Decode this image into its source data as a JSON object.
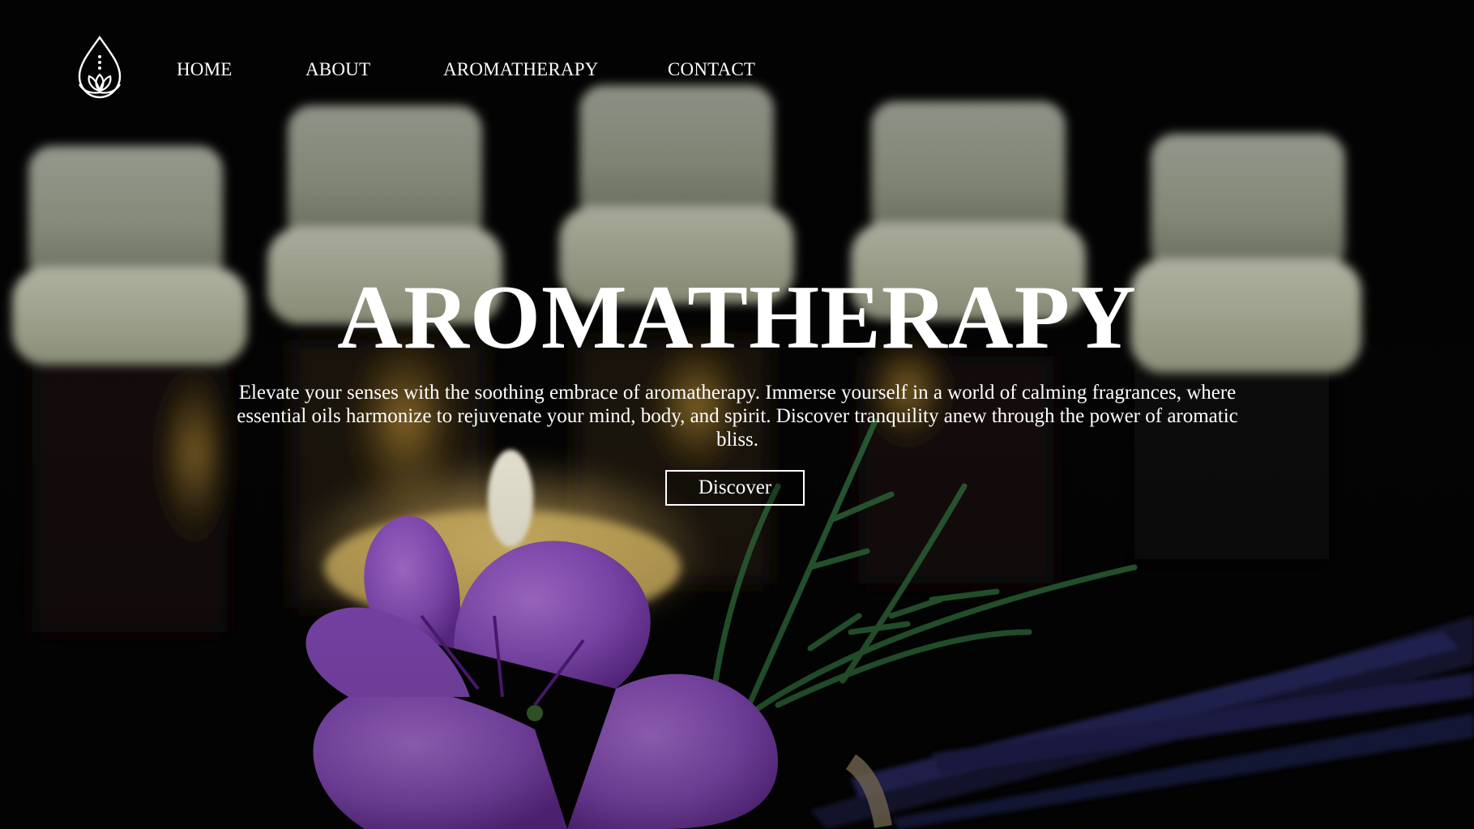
{
  "nav": {
    "logo_icon": "lotus-drop-icon",
    "items": [
      {
        "label": "HOME"
      },
      {
        "label": "ABOUT"
      },
      {
        "label": "AROMATHERAPY"
      },
      {
        "label": "CONTACT"
      }
    ]
  },
  "hero": {
    "title": "AROMATHERAPY",
    "description": "Elevate your senses with the soothing embrace of aromatherapy. Immerse yourself in a world of calming fragrances, where essential oils harmonize to rejuvenate your mind, body, and spirit. Discover tranquility anew through the power of aromatic bliss.",
    "cta_label": "Discover",
    "background_image": "essential oil bottles, candle, purple flower, rosemary and lavender"
  },
  "colors": {
    "text": "#ffffff",
    "background": "#040404",
    "flower": "#9b5fd0",
    "candle": "#f3d27a"
  }
}
